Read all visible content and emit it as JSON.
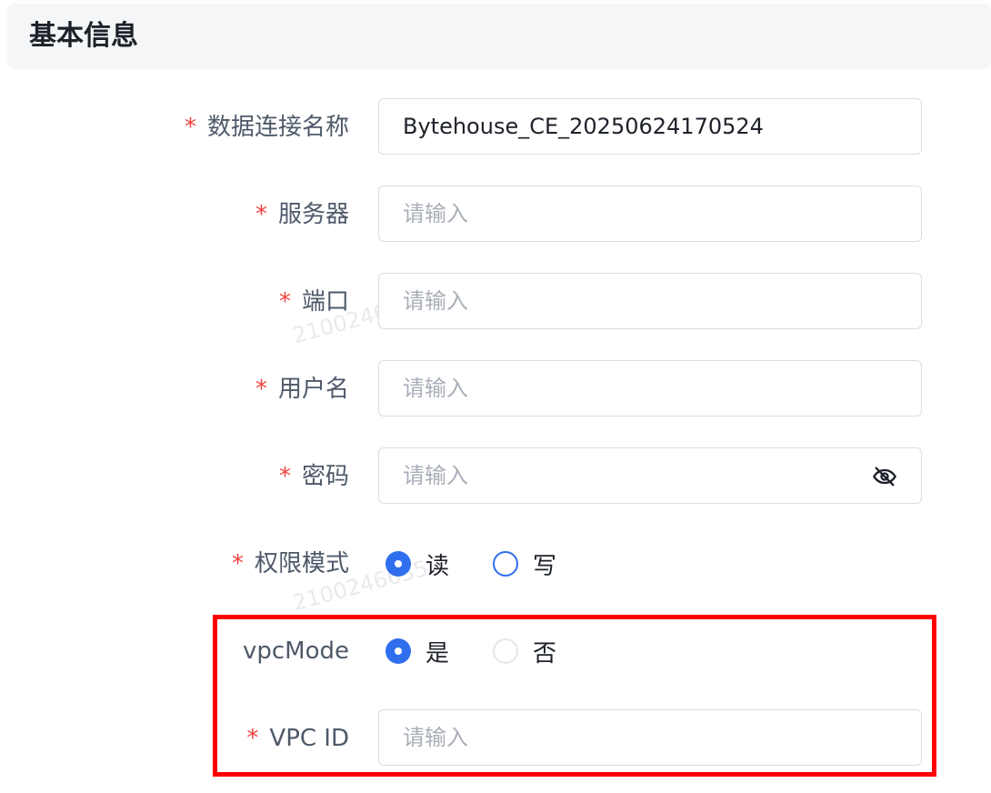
{
  "section": {
    "title": "基本信息"
  },
  "watermark": "2100246635",
  "fields": {
    "connection_name": {
      "label": "数据连接名称",
      "required": "*",
      "value": "Bytehouse_CE_20250624170524"
    },
    "server": {
      "label": "服务器",
      "required": "*",
      "placeholder": "请输入"
    },
    "port": {
      "label": "端口",
      "required": "*",
      "placeholder": "请输入"
    },
    "username": {
      "label": "用户名",
      "required": "*",
      "placeholder": "请输入"
    },
    "password": {
      "label": "密码",
      "required": "*",
      "placeholder": "请输入",
      "icon": "eye-slash-icon"
    },
    "permission_mode": {
      "label": "权限模式",
      "required": "*",
      "options": [
        "读",
        "写"
      ],
      "selected": "读"
    },
    "vpc_mode": {
      "label": "vpcMode",
      "options": [
        "是",
        "否"
      ],
      "selected": "是"
    },
    "vpc_id": {
      "label": "VPC ID",
      "required": "*",
      "placeholder": "请输入"
    }
  },
  "colors": {
    "accent": "#2f6fed",
    "required": "#f53f3f",
    "highlight": "#ff0000"
  }
}
